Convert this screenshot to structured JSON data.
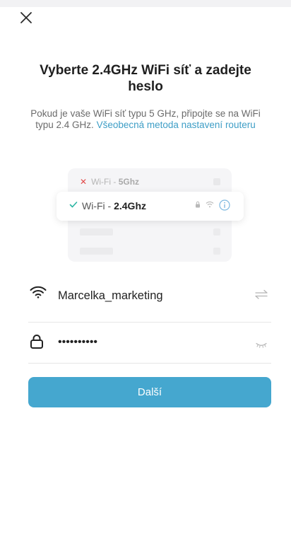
{
  "header": {
    "close_icon": "close-icon"
  },
  "title": "Vyberte 2.4GHz WiFi síť a zadejte heslo",
  "subtitle": {
    "text": "Pokud je vaše WiFi síť typu 5 GHz, připojte se na WiFi typu 2.4 GHz. ",
    "link": "Všeobecná metoda nastavení routeru"
  },
  "illustration": {
    "row_5g": {
      "prefix": "Wi-Fi - ",
      "band": "5Ghz",
      "status_icon": "x-icon"
    },
    "row_24g": {
      "prefix": "Wi-Fi - ",
      "band": "2.4Ghz",
      "status_icon": "check-icon"
    }
  },
  "form": {
    "ssid": {
      "value": "Marcelka_marketing",
      "icon": "wifi-icon",
      "action_icon": "swap-icon"
    },
    "password": {
      "value": "••••••••••",
      "icon": "lock-icon",
      "action_icon": "eye-closed-icon"
    },
    "next_label": "Další"
  },
  "colors": {
    "accent": "#45a7cf",
    "link": "#3e9ec6",
    "error": "#e24b4b",
    "success": "#2bb5a3"
  }
}
